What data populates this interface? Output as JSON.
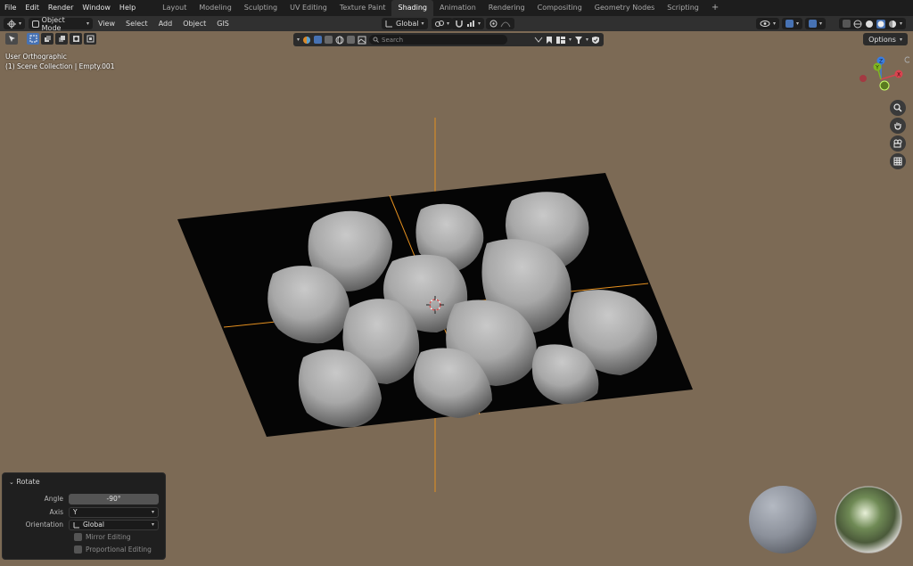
{
  "menu": [
    "File",
    "Edit",
    "Render",
    "Window",
    "Help"
  ],
  "workspaces": [
    {
      "label": "Layout",
      "active": false
    },
    {
      "label": "Modeling",
      "active": false
    },
    {
      "label": "Sculpting",
      "active": false
    },
    {
      "label": "UV Editing",
      "active": false
    },
    {
      "label": "Texture Paint",
      "active": false
    },
    {
      "label": "Shading",
      "active": true
    },
    {
      "label": "Animation",
      "active": false
    },
    {
      "label": "Rendering",
      "active": false
    },
    {
      "label": "Compositing",
      "active": false
    },
    {
      "label": "Geometry Nodes",
      "active": false
    },
    {
      "label": "Scripting",
      "active": false
    }
  ],
  "header": {
    "mode": "Object Mode",
    "menus": [
      "View",
      "Select",
      "Add",
      "Object",
      "GIS"
    ],
    "transform_orientation": "Global"
  },
  "viewport": {
    "view_name": "User Orthographic",
    "collection_info": "(1) Scene Collection | Empty.001",
    "search_placeholder": "Search",
    "options_label": "Options",
    "background_color": "#7c6a55",
    "gizmo_axes": {
      "x": "X",
      "y": "Y",
      "z": "Z"
    }
  },
  "operator_panel": {
    "title": "Rotate",
    "angle_label": "Angle",
    "angle_value": "-90°",
    "axis_label": "Axis",
    "axis_value": "Y",
    "orientation_label": "Orientation",
    "orientation_value": "Global",
    "mirror_label": "Mirror Editing",
    "mirror_checked": false,
    "proportional_label": "Proportional Editing",
    "proportional_checked": false
  },
  "colors": {
    "accent_blue": "#4772b3",
    "axis_orange": "#e5901f",
    "axis_x": "#d9434f",
    "axis_y": "#7fb522",
    "axis_z": "#3a7de0"
  },
  "icons": [
    "cursor-icon",
    "select-box-icon",
    "grid-icon",
    "hand-icon",
    "zoom-icon",
    "camera-icon",
    "eye-icon",
    "filter-icon"
  ]
}
